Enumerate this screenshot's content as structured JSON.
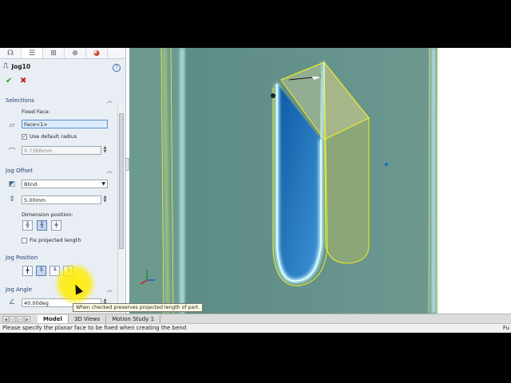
{
  "property_manager": {
    "tabs": [
      "feature-manager-icon",
      "property-manager-icon",
      "configuration-manager-icon",
      "dimxpert-icon",
      "display-manager-icon"
    ],
    "feature_title": "Jog10",
    "help_glyph": "?",
    "ok_glyph": "✔",
    "cancel_glyph": "✖",
    "selections": {
      "header": "Selections",
      "fixed_face_label": "Fixed Face:",
      "fixed_face_value": "Face<1>",
      "use_default_radius_label": "Use default radius",
      "use_default_radius_checked": true,
      "radius_value": "0.7366mm"
    },
    "jog_offset": {
      "header": "Jog Offset",
      "end_condition": "Blind",
      "distance": "5.00mm",
      "dimension_position_label": "Dimension position:",
      "fix_projected_length_label": "Fix projected length",
      "fix_projected_length_checked": false
    },
    "jog_position": {
      "header": "Jog Position"
    },
    "jog_angle": {
      "header": "Jog Angle",
      "angle": "40.00deg"
    },
    "tooltip": "When checked preserves projected length of part."
  },
  "bottom_tabs": [
    "Model",
    "3D Views",
    "Motion Study 1"
  ],
  "active_tab": "Model",
  "status_bar": {
    "message": "Please specify the planar face to be fixed when creating the bend",
    "right_text": "Fu"
  },
  "colors": {
    "panel_bg": "#e9eef4",
    "viewport_face": "#5f8e87",
    "selected_face": "#1b6fb5",
    "preview_edges": "#f2f21a",
    "glow": "#bff6ff"
  }
}
